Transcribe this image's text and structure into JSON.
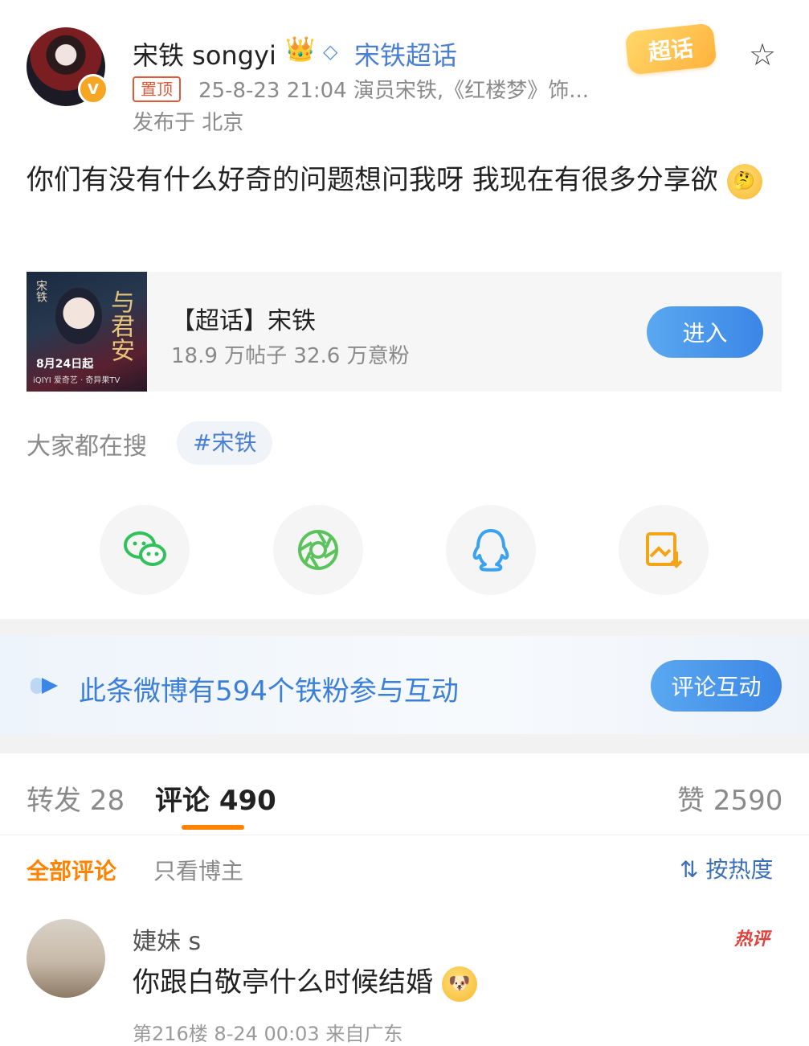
{
  "post": {
    "username": "宋铁 songyi",
    "topic_link": "宋铁超话",
    "chaohua_badge": "超话",
    "pinned_label": "置顶",
    "meta": "25-8-23 21:04  演员宋铁,《红楼梦》饰...",
    "location": "发布于 北京",
    "text": "你们有没有什么好奇的问题想问我呀 我现在有很多分享欲",
    "verified_badge": "V"
  },
  "topic_card": {
    "poster_name": "宋铁",
    "poster_title": "与君安",
    "poster_date": "8月24日起",
    "poster_platforms": "iQIYI 爱奇艺 · 奇异果TV",
    "title": "【超话】宋铁",
    "stats": "18.9 万帖子 32.6 万意粉",
    "enter_label": "进入"
  },
  "search": {
    "label": "大家都在搜",
    "hashtag": "#宋铁"
  },
  "share_icons": [
    "wechat-icon",
    "moments-icon",
    "qq-icon",
    "save-image-icon"
  ],
  "banner": {
    "text": "此条微博有594个铁粉参与互动",
    "button": "评论互动"
  },
  "tabs": {
    "repost": "转发 28",
    "comments": "评论 490",
    "likes": "赞 2590"
  },
  "filters": {
    "all": "全部评论",
    "author_only": "只看博主",
    "sort": "按热度"
  },
  "comment": {
    "name": "婕妹 s",
    "hot_label": "热评",
    "text": "你跟白敬亭什么时候结婚",
    "meta": "第216楼 8-24 00:03 来自广东"
  },
  "colors": {
    "accent_orange": "#ff8200",
    "link_blue": "#4a7fd4",
    "button_blue": "#3b86e6"
  }
}
